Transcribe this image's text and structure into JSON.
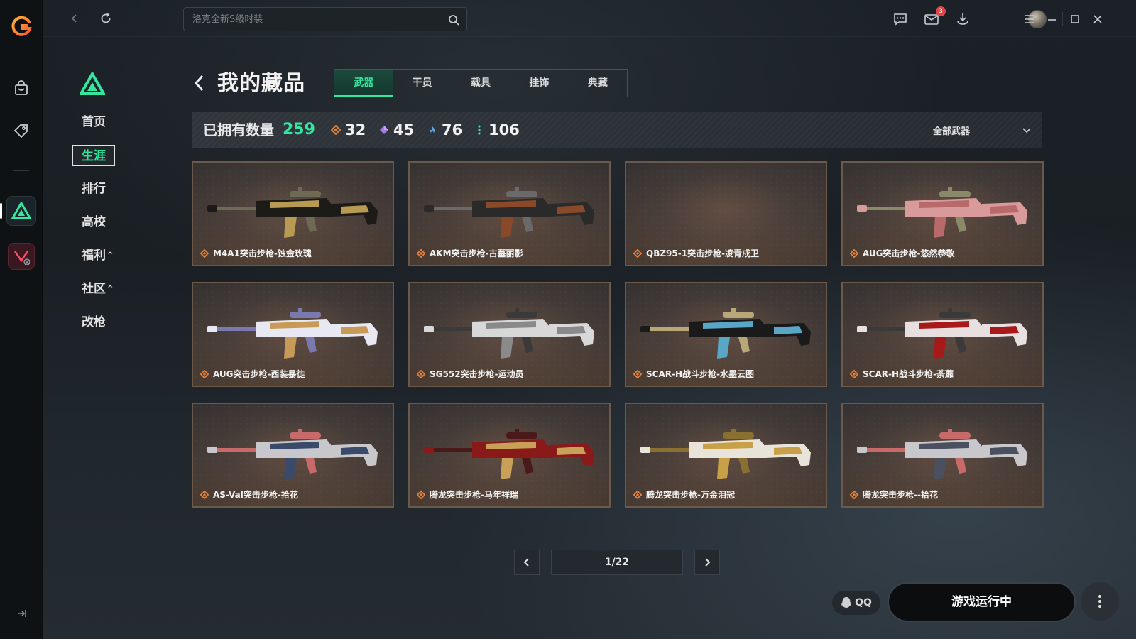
{
  "window": {
    "search_placeholder": "洛克全新S级时装",
    "mail_badge": "3"
  },
  "colors": {
    "accent": "#35e6a0",
    "gold_rarity": "#e8823a",
    "purple_rarity": "#a57be6",
    "blue_rarity": "#5aa6e6",
    "green_rarity": "#35e6a0",
    "card_border": "#6b5a4a"
  },
  "icons": {
    "rail": [
      "app-logo-icon",
      "store-bag-icon",
      "tag-icon",
      "game-triangle-icon",
      "game-valorant-icon",
      "collapse-sidebar-icon"
    ],
    "topbar": [
      "back-arrow-icon",
      "refresh-icon",
      "search-icon",
      "chat-icon",
      "mail-icon",
      "download-icon",
      "menu-icon",
      "minimize-icon",
      "maximize-icon",
      "close-icon"
    ]
  },
  "subnav": {
    "items": [
      {
        "label": "首页",
        "active": false
      },
      {
        "label": "生涯",
        "active": true
      },
      {
        "label": "排行",
        "active": false
      },
      {
        "label": "高校",
        "active": false
      },
      {
        "label": "福利",
        "caret": "^",
        "active": false
      },
      {
        "label": "社区",
        "caret": "^",
        "active": false
      },
      {
        "label": "改枪",
        "active": false
      }
    ]
  },
  "header": {
    "title": "我的藏品",
    "tabs": [
      {
        "label": "武器",
        "active": true
      },
      {
        "label": "干员",
        "active": false
      },
      {
        "label": "载具",
        "active": false
      },
      {
        "label": "挂饰",
        "active": false
      },
      {
        "label": "典藏",
        "active": false
      }
    ]
  },
  "stats": {
    "label": "已拥有数量",
    "total": "259",
    "gold": "32",
    "purple": "45",
    "blue": "76",
    "green": "106",
    "filter": "全部武器"
  },
  "cards": [
    {
      "name": "M4A1突击步枪-蚀金玫瑰",
      "palette": [
        "#1d1b18",
        "#b89a52",
        "#6e6a55"
      ]
    },
    {
      "name": "AKM突击步枪-古墓丽影",
      "palette": [
        "#2a2a2a",
        "#8a4a2a",
        "#6a6a6a"
      ]
    },
    {
      "name": "QBZ95-1突击步枪-凌青戍卫",
      "palette": []
    },
    {
      "name": "AUG突击步枪-悠然恭敬",
      "palette": [
        "#d89a9a",
        "#b86a6a",
        "#8a8a6a"
      ]
    },
    {
      "name": "AUG突击步枪-西装暴徒",
      "palette": [
        "#e8e8f2",
        "#c89a58",
        "#7a7ab0"
      ]
    },
    {
      "name": "SG552突击步枪-运动员",
      "palette": [
        "#d8d8d8",
        "#8a8a8a",
        "#3a3a3a"
      ]
    },
    {
      "name": "SCAR-H战斗步枪-水墨云图",
      "palette": [
        "#1a1a1a",
        "#5aa6c6",
        "#b8a878"
      ]
    },
    {
      "name": "SCAR-H战斗步枪-荼蘼",
      "palette": [
        "#e8e0e0",
        "#a81a1a",
        "#3a3a3a"
      ]
    },
    {
      "name": "AS-Val突击步枪-拾花",
      "palette": [
        "#c8c8cc",
        "#3a4a6a",
        "#c86a6a"
      ]
    },
    {
      "name": "腾龙突击步枪-马年祥瑞",
      "palette": [
        "#8a1a1a",
        "#c8a058",
        "#4a1a1a"
      ]
    },
    {
      "name": "腾龙突击步枪-万金泪冠",
      "palette": [
        "#e8e4da",
        "#c8a048",
        "#8a7030"
      ]
    },
    {
      "name": "腾龙突击步枪--拾花",
      "palette": [
        "#c8c8cc",
        "#4a5060",
        "#c86a6a"
      ]
    }
  ],
  "pager": {
    "text": "1/22"
  },
  "bottom": {
    "qq_label": "QQ",
    "launch_label": "游戏运行中"
  }
}
